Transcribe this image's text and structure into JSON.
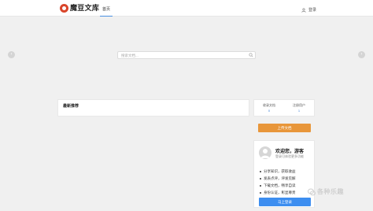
{
  "header": {
    "logo_text": "魔豆文库",
    "nav_home": "首页",
    "login_link": "登录"
  },
  "search": {
    "placeholder": "搜索文档..."
  },
  "main": {
    "recommend_title": "最新推荐"
  },
  "sidebar": {
    "stats": [
      {
        "label": "收录文档",
        "value": "0"
      },
      {
        "label": "注册用户",
        "value": "1"
      }
    ],
    "upload_label": "上传文档",
    "welcome_title": "欢迎您，游客",
    "welcome_sub": "登录可体验更多功能",
    "features": [
      "分享知识，获取收益",
      "发表点评，评发见解",
      "下载文档，畅享自读",
      "身份认证，彰显尊贵"
    ],
    "login_button": "马上登录"
  },
  "watermark": {
    "text": "各种乐趣"
  },
  "colors": {
    "accent_blue": "#3d8ef0",
    "upload_orange": "#e8963a",
    "logo_red": "#d9452b"
  }
}
